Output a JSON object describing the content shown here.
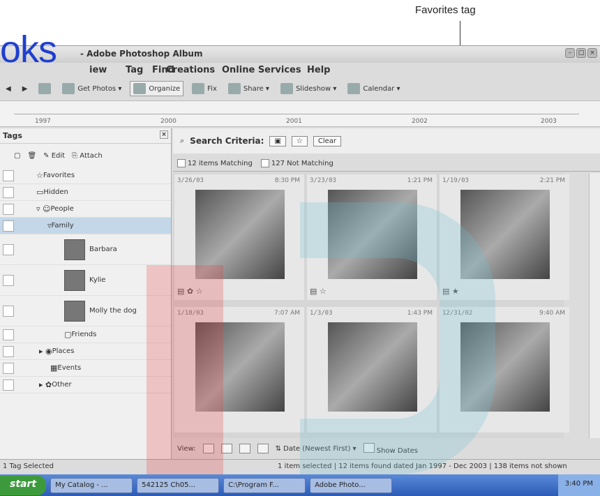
{
  "callout": {
    "label": "Favorites tag"
  },
  "window": {
    "title": "- Adobe Photoshop Album",
    "watermark": "oks"
  },
  "menu": [
    "iew",
    "Tag",
    "Find",
    "Creations",
    "Online Services",
    "Help"
  ],
  "toolbar": [
    "Get Photos ▾",
    "Organize",
    "Fix",
    "Share ▾",
    "Slideshow ▾",
    "Calendar ▾"
  ],
  "timeline": [
    "1997",
    "2000",
    "2001",
    "2002",
    "2003"
  ],
  "tags": {
    "header": "Tags",
    "tools": {
      "edit": "Edit",
      "attach": "Attach"
    },
    "items": [
      "Favorites",
      "Hidden",
      "People",
      "Family",
      "Barbara",
      "Kylie",
      "Molly the dog",
      "Friends",
      "Places",
      "Events",
      "Other"
    ]
  },
  "search": {
    "label": "Search Criteria:",
    "clear": "Clear"
  },
  "matching": {
    "matching": "12 items Matching",
    "not_matching": "127 Not Matching"
  },
  "photos": [
    {
      "date": "3/26/03",
      "time": "8:30 PM"
    },
    {
      "date": "3/23/03",
      "time": "1:21 PM"
    },
    {
      "date": "1/19/03",
      "time": "2:21 PM"
    },
    {
      "date": "1/18/03",
      "time": "7:07 AM"
    },
    {
      "date": "1/3/03",
      "time": "1:43 PM"
    },
    {
      "date": "12/31/02",
      "time": "9:40 AM"
    }
  ],
  "viewbar": {
    "label": "View:",
    "sort": "Date (Newest First) ▾",
    "show_dates": "Show Dates"
  },
  "status": {
    "left": "1 Tag Selected",
    "right": "1 item selected | 12 items found dated Jan 1997 - Dec 2003 | 138 items not shown"
  },
  "taskbar": {
    "start": "start",
    "tasks": [
      "My Catalog - ...",
      "542125 Ch05...",
      "C:\\Program F...",
      "Adobe Photo..."
    ],
    "clock": "3:40 PM"
  }
}
